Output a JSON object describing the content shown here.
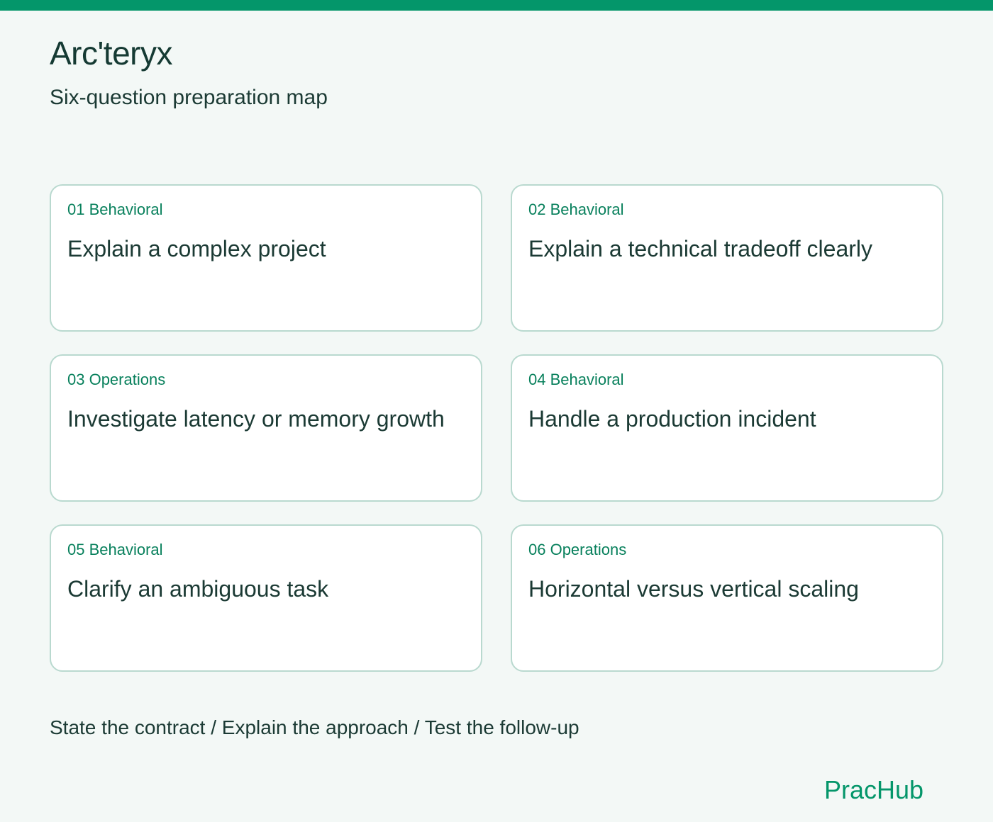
{
  "page": {
    "title": "Arc'teryx",
    "subtitle": "Six-question preparation map"
  },
  "cards": [
    {
      "tag": "01 Behavioral",
      "title": "Explain a complex project"
    },
    {
      "tag": "02 Behavioral",
      "title": "Explain a technical tradeoff clearly"
    },
    {
      "tag": "03 Operations",
      "title": "Investigate latency or memory growth"
    },
    {
      "tag": "04 Behavioral",
      "title": "Handle a production incident"
    },
    {
      "tag": "05 Behavioral",
      "title": "Clarify an ambiguous task"
    },
    {
      "tag": "06 Operations",
      "title": "Horizontal versus vertical scaling"
    }
  ],
  "footer": {
    "note": "State the contract / Explain the approach / Test the follow-up",
    "brand": "PracHub"
  },
  "colors": {
    "accent": "#04966a",
    "tag": "#08805c",
    "text": "#1b3a34",
    "background": "#f3f8f6",
    "card_border": "#b9d9cf"
  }
}
